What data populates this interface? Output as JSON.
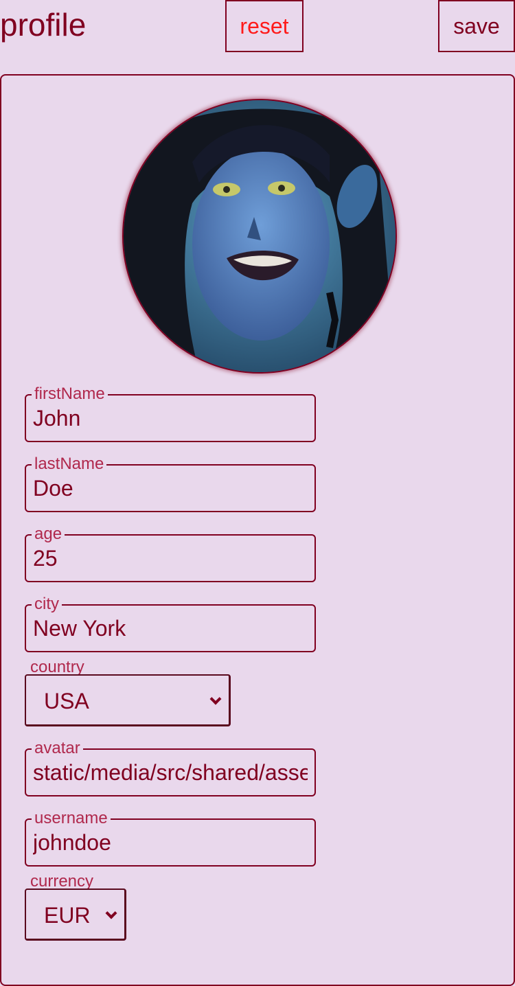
{
  "header": {
    "title": "profile",
    "reset_label": "reset",
    "save_label": "save"
  },
  "profile": {
    "avatar_alt": "profile avatar",
    "fields": {
      "firstName": {
        "label": "firstName",
        "value": "John"
      },
      "lastName": {
        "label": "lastName",
        "value": "Doe"
      },
      "age": {
        "label": "age",
        "value": "25"
      },
      "city": {
        "label": "city",
        "value": "New York"
      },
      "country": {
        "label": "country",
        "value": "USA"
      },
      "avatar": {
        "label": "avatar",
        "value": "static/media/src/shared/asse"
      },
      "username": {
        "label": "username",
        "value": "johndoe"
      },
      "currency": {
        "label": "currency",
        "value": "EUR"
      }
    }
  },
  "colors": {
    "background": "#e9d8ec",
    "primary": "#800020",
    "label": "#b0284c",
    "reset": "#ff1a1a"
  },
  "icons": {
    "select_arrow": "chevron-down-icon"
  }
}
